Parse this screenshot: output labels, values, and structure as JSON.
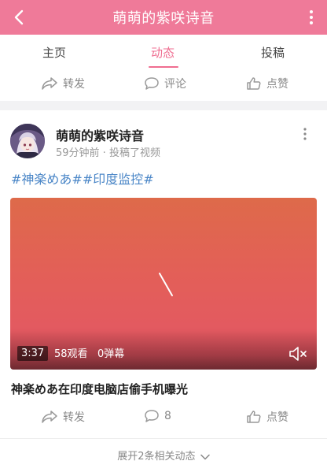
{
  "header": {
    "title": "萌萌的紫咲诗音"
  },
  "tabs": [
    {
      "label": "主页"
    },
    {
      "label": "动态"
    },
    {
      "label": "投稿"
    }
  ],
  "top_actions": {
    "repost": "转发",
    "comment": "评论",
    "like": "点赞"
  },
  "post": {
    "author": "萌萌的紫咲诗音",
    "meta": "59分钟前 · 投稿了视频",
    "topics": "#神楽めあ##印度监控#",
    "video": {
      "duration": "3:37",
      "views": "58观看",
      "danmaku": "0弹幕"
    },
    "title": "神楽めあ在印度电脑店偷手机曝光",
    "actions": {
      "repost": "转发",
      "comment": "8",
      "like": "点赞"
    }
  },
  "expand_label": "展开2条相关动态",
  "colors": {
    "brand": "#ef7a99",
    "accent": "#ef6d90",
    "topic": "#4a86c7"
  },
  "icons": [
    "back-arrow-icon",
    "more-vertical-icon",
    "share-icon",
    "comment-icon",
    "thumbs-up-icon",
    "mute-icon",
    "chevron-down-icon"
  ]
}
